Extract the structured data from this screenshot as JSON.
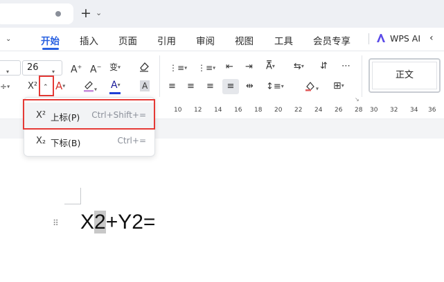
{
  "tabbar": {
    "new_tab_glyph": "+",
    "new_tab_chevron": "⌄"
  },
  "menu": {
    "items": [
      "开始",
      "插入",
      "页面",
      "引用",
      "审阅",
      "视图",
      "工具",
      "会员专享"
    ],
    "active": "开始",
    "wps_ai": "WPS AI",
    "accent": "#2860e1"
  },
  "ribbon": {
    "font_size": "26",
    "style_name": "正文",
    "superscript_label": "X²",
    "icons": [
      "increase-font",
      "decrease-font",
      "phonetic",
      "clear-format",
      "bullets",
      "numbering",
      "outdent",
      "indent",
      "char-scale",
      "text-direction",
      "line-border",
      "strikethrough",
      "font-color-A",
      "highlight",
      "font-color",
      "char-shading",
      "align-left",
      "align-center",
      "align-right",
      "justify",
      "distribute",
      "line-spacing",
      "shading",
      "borders"
    ]
  },
  "ruler": {
    "ticks": [
      "10",
      "12",
      "14",
      "16",
      "18",
      "20",
      "22",
      "24",
      "26",
      "28",
      "30",
      "32",
      "34",
      "36"
    ]
  },
  "dropdown": {
    "items": [
      {
        "icon": "X²",
        "label": "上标(P)",
        "shortcut": "Ctrl+Shift+="
      },
      {
        "icon": "X₂",
        "label": "下标(B)",
        "shortcut": "Ctrl+="
      }
    ]
  },
  "document": {
    "text_before": "X",
    "text_selected": "2",
    "text_after": "+Y2="
  },
  "highlight_color": "#e53935"
}
